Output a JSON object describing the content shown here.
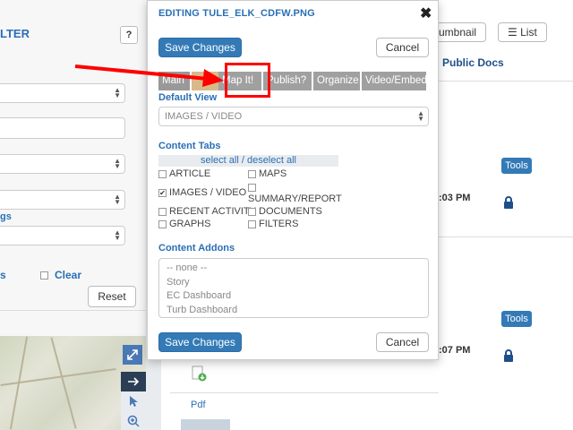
{
  "left_panel": {
    "filter_title": "LTER",
    "help_label": "?",
    "tags_label": "gs",
    "s_label": "s",
    "clear_label": "Clear",
    "reset_label": "Reset"
  },
  "right_panel": {
    "thumbnail_label": "umbnail",
    "list_label": "List",
    "public_docs": "Public Docs",
    "tools_label": "Tools",
    "time1": ":03 PM",
    "time2": ":07 PM"
  },
  "under_panel": {
    "pdf_label": "Pdf"
  },
  "modal": {
    "title": "EDITING TULE_ELK_CDFW.PNG",
    "close_glyph": "✖",
    "save_label": "Save Changes",
    "cancel_label": "Cancel",
    "tabs": [
      {
        "label": "Main"
      },
      {
        "label": "Map It!"
      },
      {
        "label": "Publish?"
      },
      {
        "label": "Organize"
      },
      {
        "label": "Video/Embed"
      }
    ],
    "default_view_label": "Default View",
    "default_view_value": "IMAGES / VIDEO",
    "content_tabs_label": "Content Tabs",
    "select_all": "select all",
    "slash": " / ",
    "deselect_all": "deselect all",
    "checkboxes": [
      {
        "label": "ARTICLE",
        "checked": false
      },
      {
        "label": "MAPS",
        "checked": false
      },
      {
        "label": "IMAGES / VIDEO",
        "checked": true
      },
      {
        "label": "SUMMARY/REPORT",
        "checked": false
      },
      {
        "label": "RECENT ACTIVITY",
        "checked": false
      },
      {
        "label": "DOCUMENTS",
        "checked": false
      },
      {
        "label": "GRAPHS",
        "checked": false
      },
      {
        "label": "FILTERS",
        "checked": false
      }
    ],
    "addons_label": "Content Addons",
    "addons": [
      "-- none --",
      "Story",
      "EC Dashboard",
      "Turb Dashboard"
    ]
  },
  "colors": {
    "accent": "#2a6fb5",
    "primary_button": "#337ab7",
    "tab_bg": "#a0a0a0",
    "annotation": "#ff0000"
  }
}
